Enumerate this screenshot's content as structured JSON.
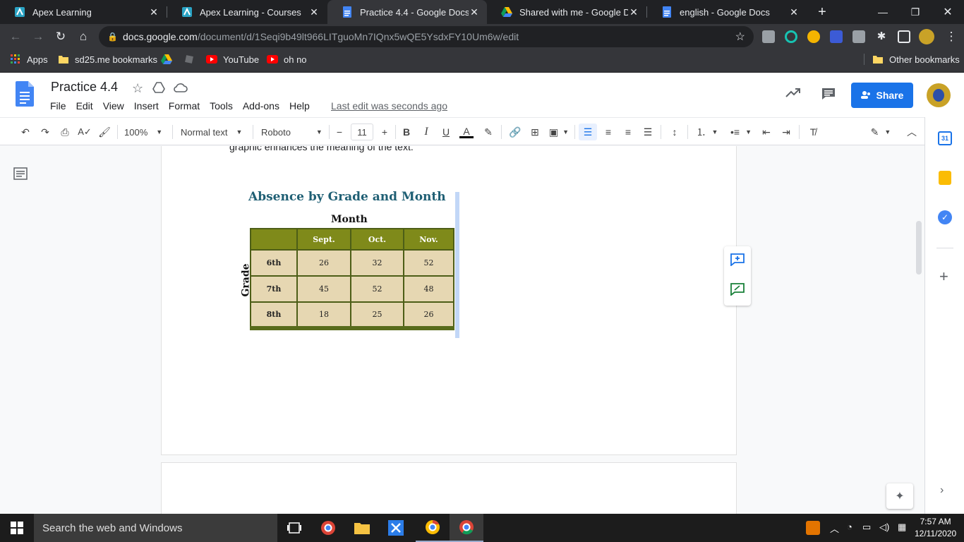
{
  "browser": {
    "tabs": [
      {
        "title": "Apex Learning",
        "active": false
      },
      {
        "title": "Apex Learning - Courses",
        "active": false
      },
      {
        "title": "Practice 4.4 - Google Docs",
        "active": true
      },
      {
        "title": "Shared with me - Google Drive",
        "active": false
      },
      {
        "title": "english - Google Docs",
        "active": false
      }
    ],
    "url_host": "docs.google.com",
    "url_path": "/document/d/1Seqi9b49lt966LITguoMn7IQnx5wQE5YsdxFY10Um6w/edit",
    "bookmarks": [
      "Apps",
      "sd25.me bookmarks",
      "",
      "",
      "YouTube",
      "oh no"
    ],
    "other_bookmarks": "Other bookmarks"
  },
  "doc": {
    "title": "Practice 4.4",
    "menu": [
      "File",
      "Edit",
      "View",
      "Insert",
      "Format",
      "Tools",
      "Add-ons",
      "Help"
    ],
    "last_edit": "Last edit was seconds ago",
    "share_label": "Share"
  },
  "toolbar": {
    "zoom": "100%",
    "style": "Normal text",
    "font": "Roboto",
    "font_size": "11"
  },
  "page": {
    "body_text": "graphic enhances the meaning of the text."
  },
  "figure": {
    "title": "Absence by Grade and Month",
    "column_axis": "Month",
    "row_axis": "Grade",
    "columns": [
      "Sept.",
      "Oct.",
      "Nov."
    ],
    "rows": [
      {
        "grade": "6th",
        "values": [
          "26",
          "32",
          "52"
        ]
      },
      {
        "grade": "7th",
        "values": [
          "45",
          "52",
          "48"
        ]
      },
      {
        "grade": "8th",
        "values": [
          "18",
          "25",
          "26"
        ]
      }
    ]
  },
  "taskbar": {
    "search_placeholder": "Search the web and Windows",
    "time": "7:57 AM",
    "date": "12/11/2020"
  },
  "colors": {
    "accent": "#1a73e8",
    "table_header": "#7f8a1a",
    "table_cell": "#e6d7b2",
    "figure_title": "#1f5f74"
  }
}
